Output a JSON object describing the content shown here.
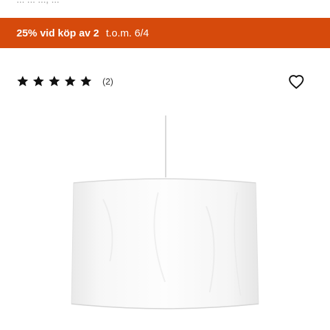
{
  "top_fragment": "... ... ..., ...",
  "promo": {
    "main": "25% vid köp av 2",
    "validity": "t.o.m. 6/4",
    "background_color": "#d64a0c",
    "text_color": "#ffffff"
  },
  "rating": {
    "stars": 5,
    "max_stars": 5,
    "count_label": "(2)",
    "star_icon": "star-icon"
  },
  "favorite": {
    "icon": "heart-icon"
  },
  "product_image": {
    "subject": "white-drum-pendant-lamp-shade"
  }
}
